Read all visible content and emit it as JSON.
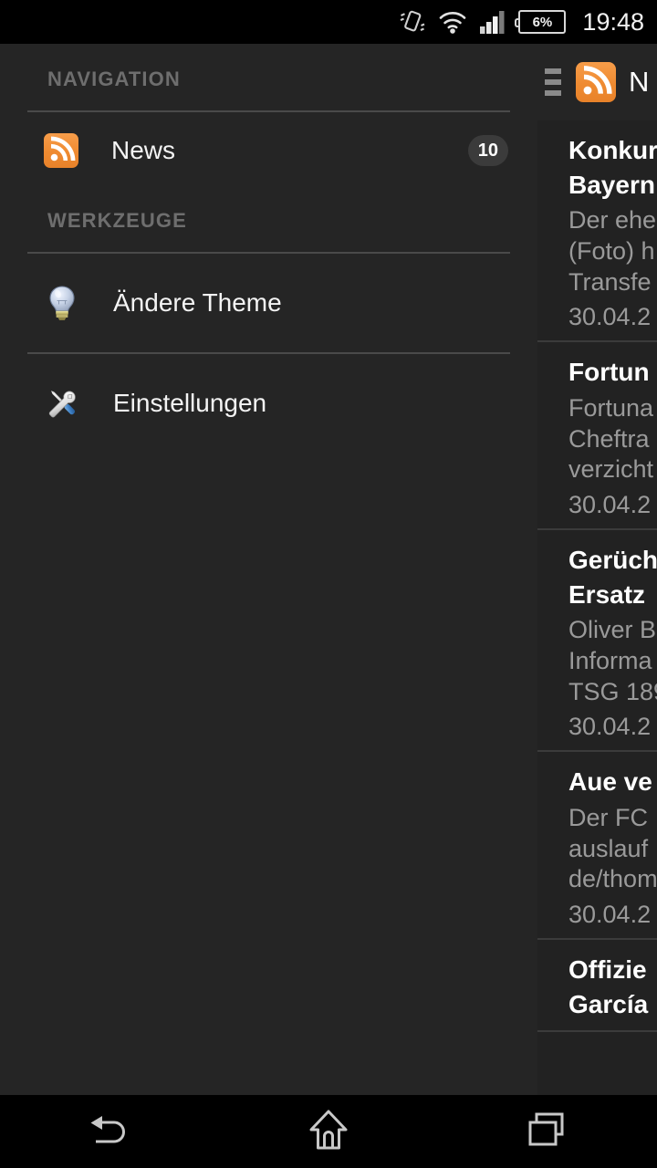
{
  "status_bar": {
    "icons": [
      "vibrate-off-icon",
      "wifi-icon",
      "cellular-signal-icon",
      "battery-icon"
    ],
    "battery_percent": "6%",
    "clock": "19:48"
  },
  "drawer": {
    "sections": [
      {
        "header": "NAVIGATION",
        "items": [
          {
            "icon": "rss-icon",
            "label": "News",
            "badge": "10"
          }
        ]
      },
      {
        "header": "WERKZEUGE",
        "items": [
          {
            "icon": "lightbulb-icon",
            "label": "Ändere Theme",
            "badge": ""
          },
          {
            "icon": "tools-icon",
            "label": "Einstellungen",
            "badge": ""
          }
        ]
      }
    ]
  },
  "content": {
    "actionbar": {
      "drag_handle": "drag-handle-icon",
      "app_icon": "rss-icon",
      "title": "N"
    },
    "news": [
      {
        "title": "Konkur\nBayern",
        "snippet": "Der ehe\n(Foto) h\nTransfe",
        "date": "30.04.2"
      },
      {
        "title": "Fortun",
        "snippet": "Fortuna\nCheftra\nverzicht",
        "date": "30.04.2"
      },
      {
        "title": "Gerüch\nErsatz",
        "snippet": "Oliver B\nInforma\nTSG 189",
        "date": "30.04.2"
      },
      {
        "title": "Aue ve",
        "snippet": "Der FC\nauslauf\nde/thom",
        "date": "30.04.2"
      },
      {
        "title": "Offizie\nGarcía",
        "snippet": "",
        "date": ""
      }
    ]
  },
  "navbar": {
    "buttons": [
      {
        "name": "back-button",
        "icon": "back-arrow-icon"
      },
      {
        "name": "home-button",
        "icon": "home-icon"
      },
      {
        "name": "recents-button",
        "icon": "recent-apps-icon"
      }
    ]
  },
  "colors": {
    "accent_orange": "#ef8b31",
    "drawer_bg": "#252525",
    "content_bg": "#222222",
    "system_bg": "#000000",
    "primary_text": "#f4f4f4",
    "secondary_text": "#9a9a9a",
    "section_header_text": "#6e6e6e"
  }
}
